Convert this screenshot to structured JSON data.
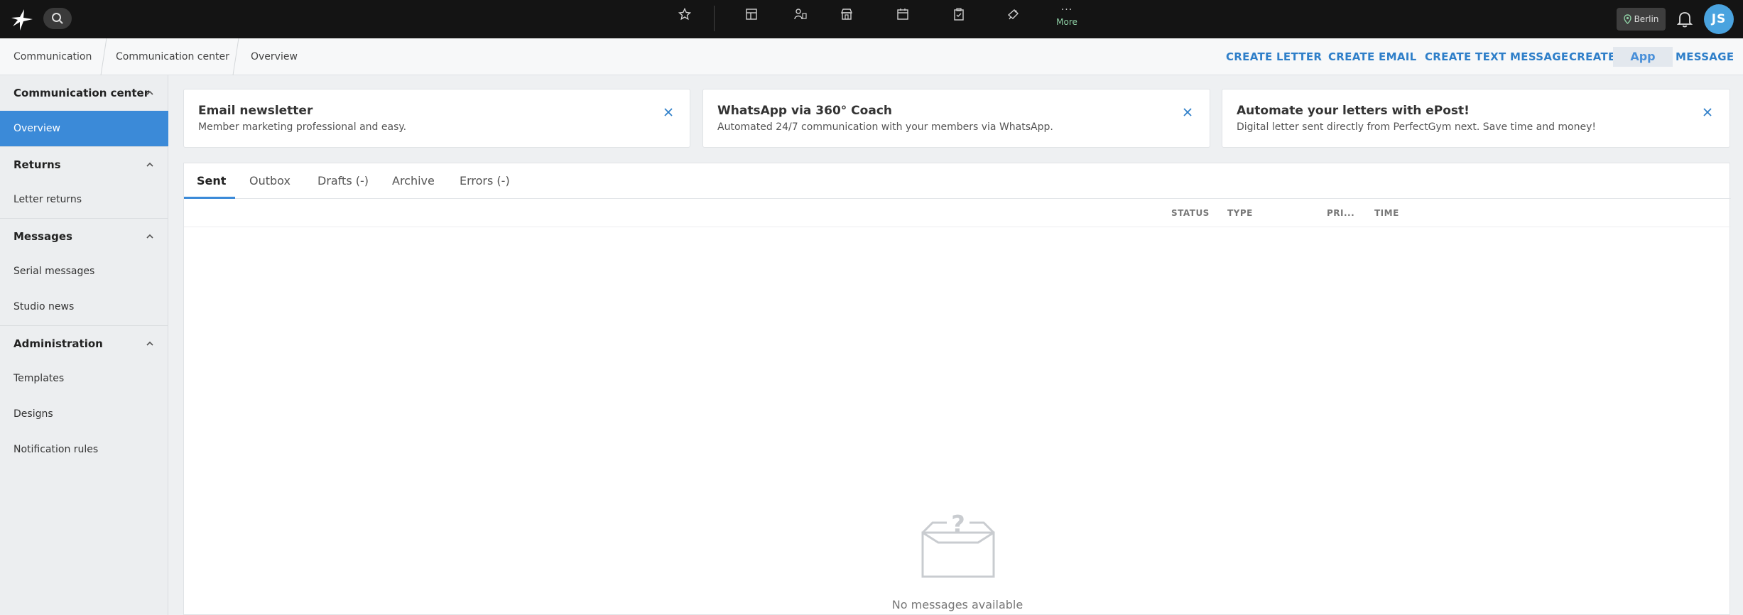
{
  "app": {
    "location": "Berlin",
    "user_initials": "JS",
    "more_label": "More",
    "more_dots": "···",
    "accent_color": "#3b8ad8",
    "brand_dark": "#141414"
  },
  "nav_icons": [
    "star-icon",
    "dashboard-icon",
    "members-icon",
    "store-icon",
    "calendar-icon",
    "clipboard-check-icon",
    "marketing-icon"
  ],
  "breadcrumb": [
    "Communication",
    "Communication center",
    "Overview"
  ],
  "actions": {
    "create_letter": "CREATE LETTER",
    "create_email": "CREATE EMAIL",
    "create_text_message": "CREATE TEXT MESSAGE",
    "create": "CREATE",
    "app": "App",
    "message": "MESSAGE"
  },
  "sidebar": {
    "groups": [
      {
        "label": "Communication center",
        "items": [
          "Overview"
        ]
      },
      {
        "label": "Returns",
        "items": [
          "Letter returns"
        ]
      },
      {
        "label": "Messages",
        "items": [
          "Serial messages",
          "Studio news"
        ]
      },
      {
        "label": "Administration",
        "items": [
          "Templates",
          "Designs",
          "Notification rules"
        ]
      }
    ],
    "active_item": "Overview"
  },
  "cards": [
    {
      "title": "Email newsletter",
      "text": "Member marketing professional and easy."
    },
    {
      "title": "WhatsApp via 360° Coach",
      "text": "Automated 24/7 communication with your members via WhatsApp."
    },
    {
      "title": "Automate your letters with ePost!",
      "text": "Digital letter sent directly from PerfectGym next. Save time and money!"
    }
  ],
  "tabs": [
    "Sent",
    "Outbox",
    "Drafts (-)",
    "Archive",
    "Errors (-)"
  ],
  "active_tab": "Sent",
  "columns": [
    "STATUS",
    "TYPE",
    "PRI...",
    "TIME"
  ],
  "empty_state": {
    "icon": "question-box-icon",
    "text": "No messages available"
  }
}
